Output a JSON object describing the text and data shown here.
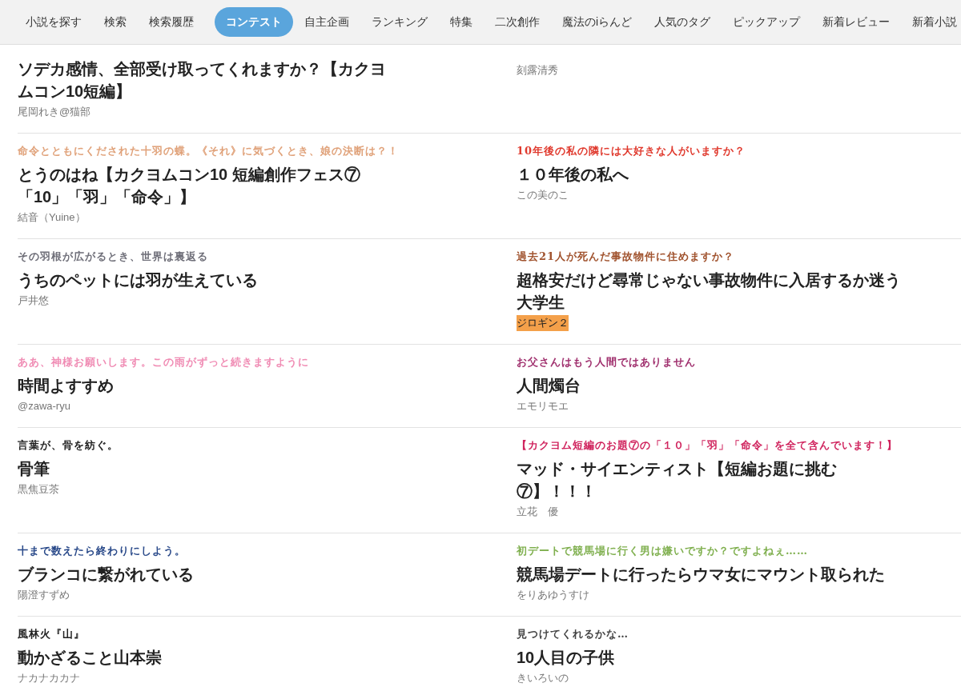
{
  "nav": {
    "groups": [
      [
        {
          "label": "小説を探す",
          "selected": false
        },
        {
          "label": "検索",
          "selected": false
        },
        {
          "label": "検索履歴",
          "selected": false
        }
      ],
      [
        {
          "label": "コンテスト",
          "selected": true
        },
        {
          "label": "自主企画",
          "selected": false
        },
        {
          "label": "ランキング",
          "selected": false
        },
        {
          "label": "特集",
          "selected": false
        },
        {
          "label": "二次創作",
          "selected": false
        },
        {
          "label": "魔法のiらんど",
          "selected": false
        },
        {
          "label": "人気のタグ",
          "selected": false
        },
        {
          "label": "ピックアップ",
          "selected": false
        },
        {
          "label": "新着レビュー",
          "selected": false
        },
        {
          "label": "新着小説",
          "selected": false
        }
      ]
    ]
  },
  "rows": [
    [
      {
        "title": "ソデカ感情、全部受け取ってくれますか？【カクヨムコン10短編】",
        "author": "尾岡れき@猫部",
        "highlighted": false
      },
      {
        "author": "刻露清秀",
        "highlighted": false
      }
    ],
    [
      {
        "catchphrase": "命令とともにくだされた十羽の蝶。《それ》に気づくとき、娘の決断は？！",
        "color": "#e0a27a",
        "title": "とうのはね【カクヨムコン10 短編創作フェス⑦「10」「羽」「命令」】",
        "author": "結音（Yuine）",
        "highlighted": false
      },
      {
        "catchphrase": "10年後の私の隣には大好きな人がいますか？",
        "color": "#e03a2e",
        "title": "１０年後の私へ",
        "author": "この美のこ",
        "highlighted": false
      }
    ],
    [
      {
        "catchphrase": "その羽根が広がるとき、世界は裏返る",
        "color": "#6e6e78",
        "title": "うちのペットには羽が生えている",
        "author": "戸井悠",
        "highlighted": false
      },
      {
        "catchphrase": "過去21人が死んだ事故物件に住めますか？",
        "color": "#a0522d",
        "title": "超格安だけど尋常じゃない事故物件に入居するか迷う大学生",
        "author": "ジロギン２",
        "highlighted": true
      }
    ],
    [
      {
        "catchphrase": "ああ、神様お願いします。この雨がずっと続きますように",
        "color": "#f08cb4",
        "title": "時間よすすめ",
        "author": "@zawa-ryu",
        "highlighted": false
      },
      {
        "catchphrase": "お父さんはもう人間ではありません",
        "color": "#a0306e",
        "title": "人間燭台",
        "author": "エモリモエ",
        "highlighted": false
      }
    ],
    [
      {
        "catchphrase": "言葉が、骨を紡ぐ。",
        "color": "#222222",
        "title": "骨筆",
        "author": "黒焦豆茶",
        "highlighted": false
      },
      {
        "catchphrase": "【カクヨム短編のお題⑦の「１０」「羽」「命令」を全て含んでいます！】",
        "color": "#d0245e",
        "title": "マッド・サイエンティスト【短編お題に挑む⑦】！！！",
        "author": "立花　優",
        "highlighted": false
      }
    ],
    [
      {
        "catchphrase": "十まで数えたら終わりにしよう。",
        "color": "#2a4a8a",
        "title": "ブランコに繋がれている",
        "author": "陽澄すずめ",
        "highlighted": false
      },
      {
        "catchphrase": "初デートで競馬場に行く男は嫌いですか？ですよねぇ……",
        "color": "#80b050",
        "title": "競馬場デートに行ったらウマ女にマウント取られた",
        "author": "をりあゆうすけ",
        "highlighted": false
      }
    ],
    [
      {
        "catchphrase": "風林火『山』",
        "color": "#222222",
        "title": "動かざること山本崇",
        "author": "ナカナカカナ",
        "highlighted": false
      },
      {
        "catchphrase": "見つけてくれるかな…",
        "color": "#444444",
        "title": "10人目の子供",
        "author": "きいろいの",
        "highlighted": false
      }
    ]
  ]
}
